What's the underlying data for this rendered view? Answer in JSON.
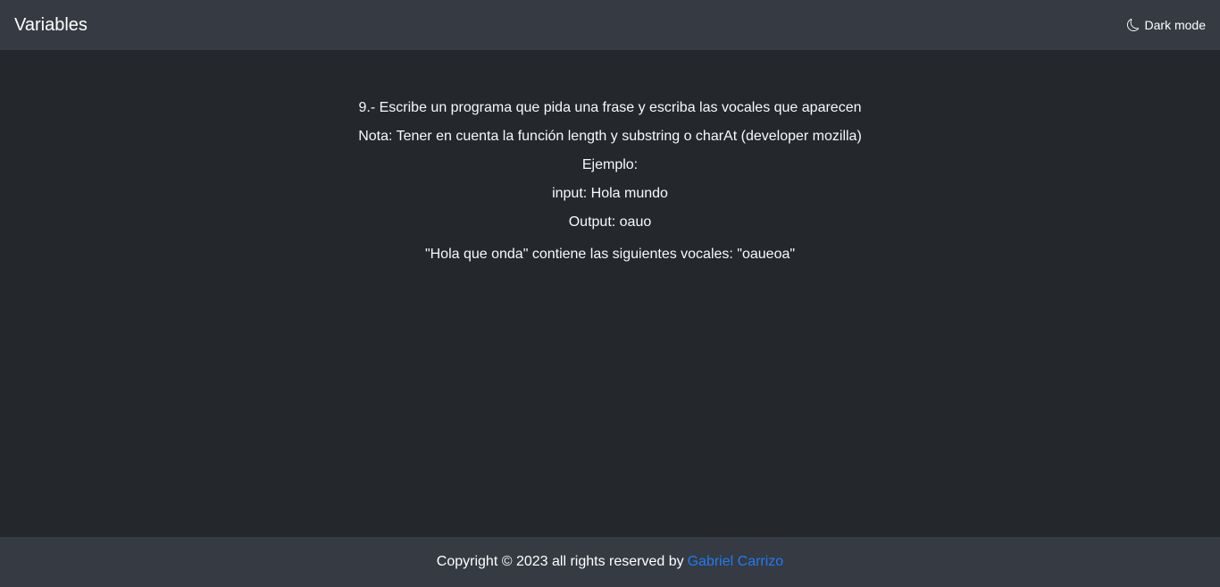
{
  "navbar": {
    "brand": "Variables",
    "dark_mode_label": "Dark mode",
    "dark_mode_icon": "moon-icon"
  },
  "exercise": {
    "lines": [
      "9.- Escribe un programa que pida una frase y escriba las vocales que aparecen",
      "Nota: Tener en cuenta la función length y substring o charAt (developer mozilla)",
      "Ejemplo:",
      "input: Hola mundo",
      "Output: oauo"
    ],
    "result": "\"Hola que onda\" contiene las siguientes vocales: \"oaueoa\""
  },
  "footer": {
    "copyright": "Copyright © 2023 all rights reserved by",
    "author": "Gabriel Carrizo"
  },
  "colors": {
    "background": "#24282d",
    "bars": "#363a43",
    "link": "#1f7cf2"
  }
}
